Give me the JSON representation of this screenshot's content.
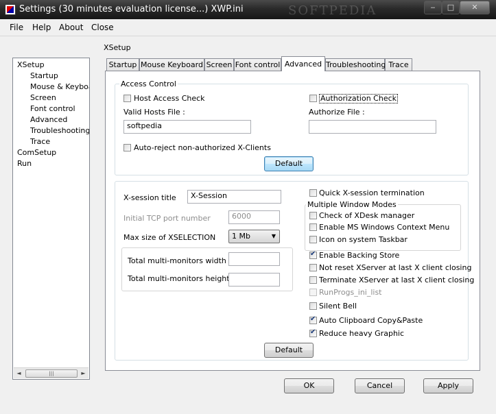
{
  "window": {
    "title": "Settings (30 minutes evaluation license...) XWP.ini",
    "watermark": "SOFTPEDIA",
    "minimize": "‒",
    "maximize": "□",
    "close": "✕"
  },
  "menu": [
    "File",
    "Help",
    "About",
    "Close"
  ],
  "tree": {
    "items": [
      "XSetup",
      "Startup",
      "Mouse & Keyboard",
      "Screen",
      "Font control",
      "Advanced",
      "Troubleshooting",
      "Trace",
      "ComSetup",
      "Run"
    ],
    "scroll_left": "◄",
    "scroll_right": "►",
    "thumb_grip": "|||"
  },
  "section_title": "XSetup",
  "tabs": [
    "Startup",
    "Mouse  Keyboard",
    "Screen",
    "Font control",
    "Advanced",
    "Troubleshooting",
    "Trace"
  ],
  "active_tab": "Advanced",
  "access_control": {
    "group_label": "Access Control",
    "host_access_check": {
      "label": "Host Access Check",
      "checked": false
    },
    "authorization_check": {
      "label": "Authorization Check",
      "checked": false
    },
    "valid_hosts_label": "Valid Hosts File :",
    "valid_hosts_value": "softpedia",
    "authorize_file_label": "Authorize File :",
    "authorize_file_value": "",
    "auto_reject": {
      "label": "Auto-reject non-authorized X-Clients",
      "checked": false
    },
    "default_button": "Default"
  },
  "session": {
    "xsession_title_label": "X-session title",
    "xsession_title_value": "X-Session",
    "tcp_port_label": "Initial TCP port number",
    "tcp_port_value": "6000",
    "xselection_label": "Max size of XSELECTION",
    "xselection_value": "1 Mb",
    "monitors_width_label": "Total multi-monitors width",
    "monitors_width_value": "",
    "monitors_height_label": "Total multi-monitors height",
    "monitors_height_value": "",
    "quick_termination": {
      "label": "Quick X-session termination",
      "checked": false
    },
    "multiple_window_modes": "Multiple Window Modes",
    "check_xdesk": {
      "label": "Check of XDesk manager",
      "checked": false
    },
    "ms_context_menu": {
      "label": "Enable MS Windows Context Menu",
      "checked": false
    },
    "icon_taskbar": {
      "label": "Icon on system Taskbar",
      "checked": false
    },
    "backing_store": {
      "label": "Enable Backing Store",
      "checked": true
    },
    "not_reset": {
      "label": "Not reset XServer at last X client closing",
      "checked": false
    },
    "terminate": {
      "label": "Terminate XServer at last X client closing",
      "checked": false
    },
    "runprogs": {
      "label": "RunProgs_ini_list",
      "checked": false
    },
    "silent_bell": {
      "label": "Silent Bell",
      "checked": false
    },
    "auto_clipboard": {
      "label": "Auto Clipboard Copy&Paste",
      "checked": true
    },
    "reduce_graphic": {
      "label": "Reduce heavy Graphic",
      "checked": true
    },
    "default_button": "Default"
  },
  "footer": {
    "ok": "OK",
    "cancel": "Cancel",
    "apply": "Apply"
  },
  "colors": {
    "titlebar": "#2a2a2a",
    "accent": "#3c7fb1"
  }
}
